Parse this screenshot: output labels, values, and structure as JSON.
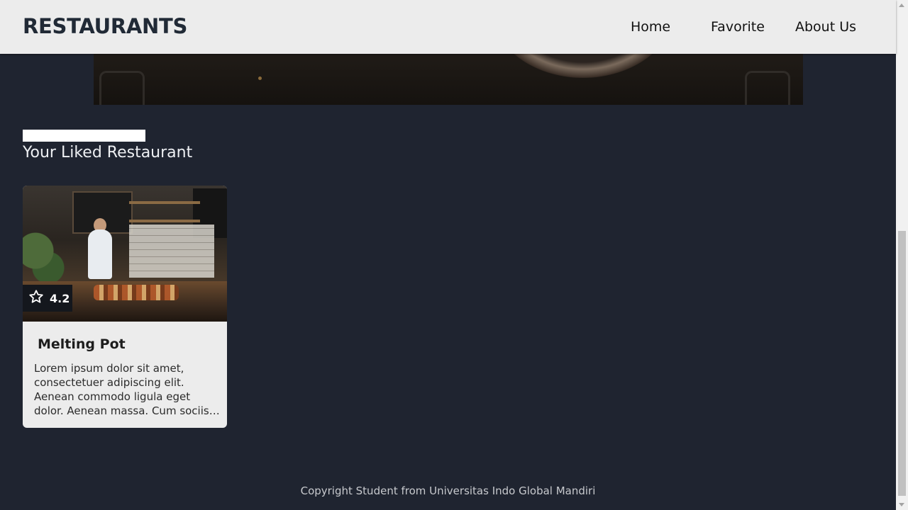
{
  "header": {
    "brand": "RESTAURANTS",
    "nav": [
      {
        "label": "Home"
      },
      {
        "label": "Favorite"
      },
      {
        "label": "About Us"
      }
    ]
  },
  "favorites": {
    "title": "Your Liked Restaurant",
    "restaurants": [
      {
        "name": "Melting Pot",
        "rating": "4.2",
        "rating_icon": "star-outline-icon",
        "description": "Lorem ipsum dolor sit amet, consectetuer adipiscing elit. Aenean commodo ligula eget dolor. Aenean massa. Cum sociis natoque penatibus et magnis dis parturient montes, nascetur ridiculus mus."
      }
    ]
  },
  "footer": {
    "text": "Copyright Student from Universitas Indo Global Mandiri"
  },
  "colors": {
    "page_background": "#1f2430",
    "navbar_background": "#ececec",
    "card_background": "#ececec"
  }
}
